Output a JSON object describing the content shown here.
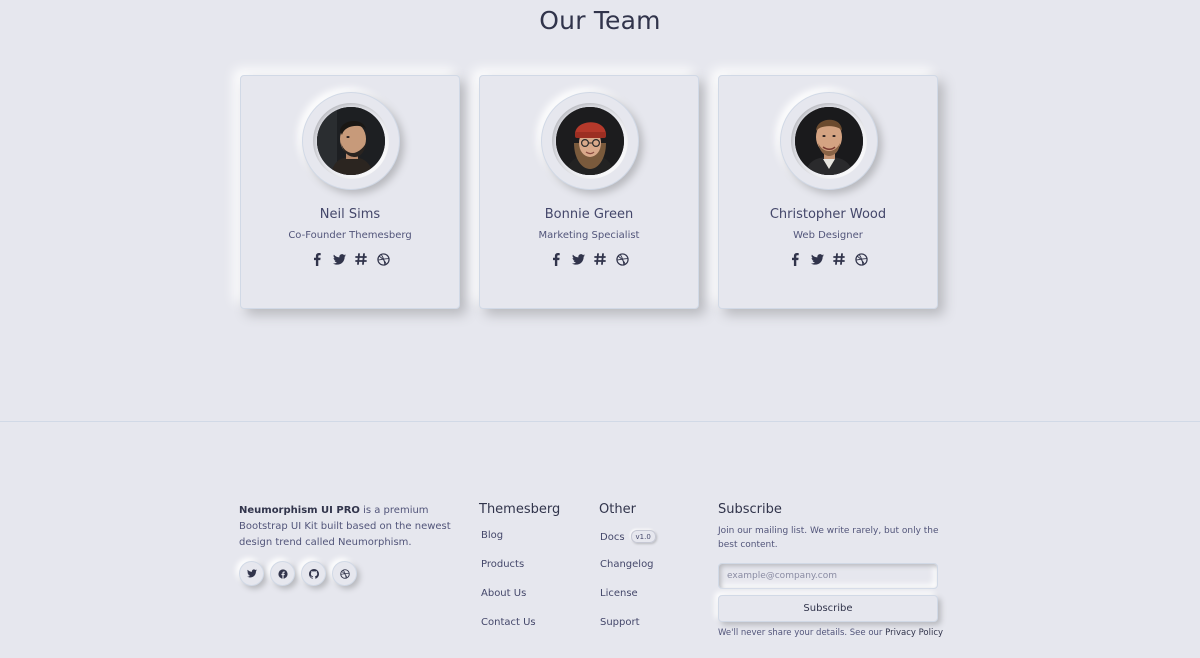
{
  "section_title": "Our Team",
  "team": [
    {
      "name": "Neil Sims",
      "role": "Co-Founder Themesberg",
      "photo": "man-with-beard-photo"
    },
    {
      "name": "Bonnie Green",
      "role": "Marketing Specialist",
      "photo": "woman-with-red-beanie-photo"
    },
    {
      "name": "Christopher Wood",
      "role": "Web Designer",
      "photo": "smiling-man-photo"
    }
  ],
  "card_social_icons": [
    "facebook-icon",
    "twitter-icon",
    "slack-icon",
    "dribbble-icon"
  ],
  "footer": {
    "about": {
      "brand": "Neumorphism UI PRO",
      "text": " is a premium Bootstrap UI Kit built based on the newest design trend called Neumorphism.",
      "social_icons": [
        "twitter-icon",
        "facebook-icon",
        "github-icon",
        "dribbble-icon"
      ]
    },
    "themesberg": {
      "title": "Themesberg",
      "links": [
        "Blog",
        "Products",
        "About Us",
        "Contact Us"
      ]
    },
    "other": {
      "title": "Other",
      "links": [
        "Docs",
        "Changelog",
        "License",
        "Support"
      ],
      "docs_badge": "v1.0"
    },
    "subscribe": {
      "title": "Subscribe",
      "text": "Join our mailing list. We write rarely, but only the best content.",
      "placeholder": "example@company.com",
      "button": "Subscribe",
      "privacy_text": "We'll never share your details. See our ",
      "privacy_link": "Privacy Policy"
    }
  },
  "colors": {
    "background": "#e6e7ee",
    "text": "#44476a",
    "heading": "#31344b",
    "border": "#d1d9e6"
  }
}
